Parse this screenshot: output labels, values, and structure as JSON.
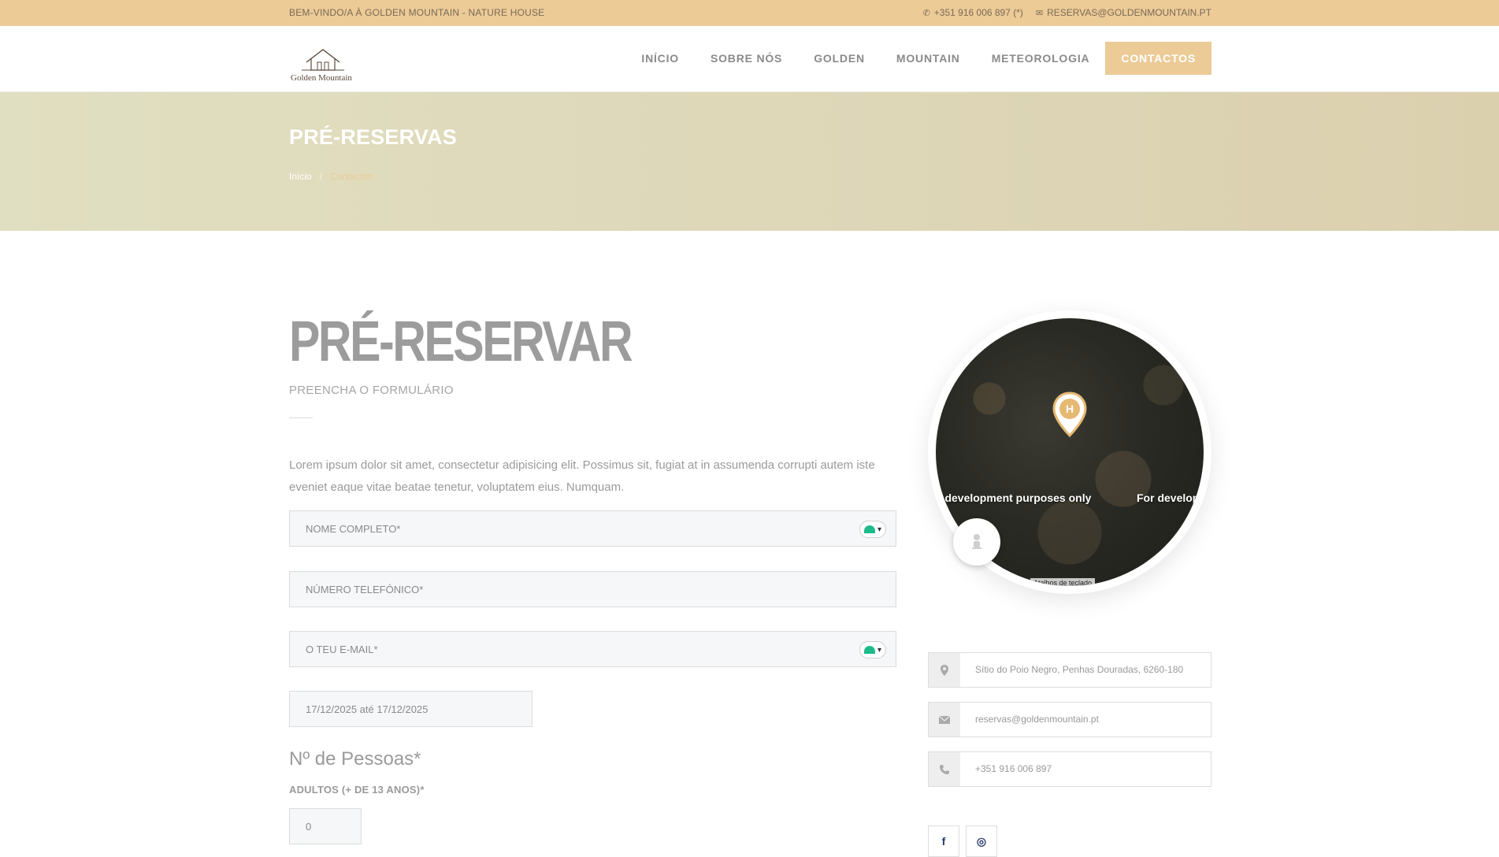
{
  "topbar": {
    "welcome": "BEM-VINDO/A À GOLDEN MOUNTAIN - NATURE HOUSE",
    "phone": "+351 916 006 897 (*)",
    "email": "RESERVAS@GOLDENMOUNTAIN.PT"
  },
  "logo": {
    "text": "Golden Mountain"
  },
  "nav": {
    "items": [
      {
        "label": "INÍCIO"
      },
      {
        "label": "SOBRE NÓS"
      },
      {
        "label": "GOLDEN"
      },
      {
        "label": "MOUNTAIN"
      },
      {
        "label": "METEOROLOGIA"
      },
      {
        "label": "CONTACTOS"
      }
    ],
    "active_color": "#eccb97"
  },
  "hero": {
    "title": "PRÉ-RESERVAS",
    "breadcrumb": {
      "home": "Início",
      "separator": "/",
      "current": "Contactos"
    }
  },
  "form": {
    "title": "PRÉ-RESERVAR",
    "subtitle": "PREENCHA O FORMULÁRIO",
    "intro": "Lorem ipsum dolor sit amet, consectetur adipisicing elit. Possimus sit, fugiat at in assumenda corrupti autem iste eveniet eaque vitae beatae tenetur, voluptatem eius. Numquam.",
    "name_placeholder": "NOME COMPLETO*",
    "phone_placeholder": "NÚMERO TELEFÓNICO*",
    "email_placeholder": "O TEU E-MAIL*",
    "dates_value": "17/12/2025 até 17/12/2025",
    "people_heading": "Nº de Pessoas*",
    "adults_label": "ADULTOS (+ DE 13 ANOS)*",
    "adults_value": "0"
  },
  "map": {
    "dev_text": "For development purposes only",
    "shortcuts": "Atalhos de teclado",
    "pin_letter": "H"
  },
  "contact": {
    "address": "Sítio do Poio Negro, Penhas Douradas, 6260-180",
    "email": "reservas@goldenmountain.pt",
    "phone": "+351 916 006 897"
  },
  "social": {
    "facebook": "f",
    "instagram": "◎"
  }
}
